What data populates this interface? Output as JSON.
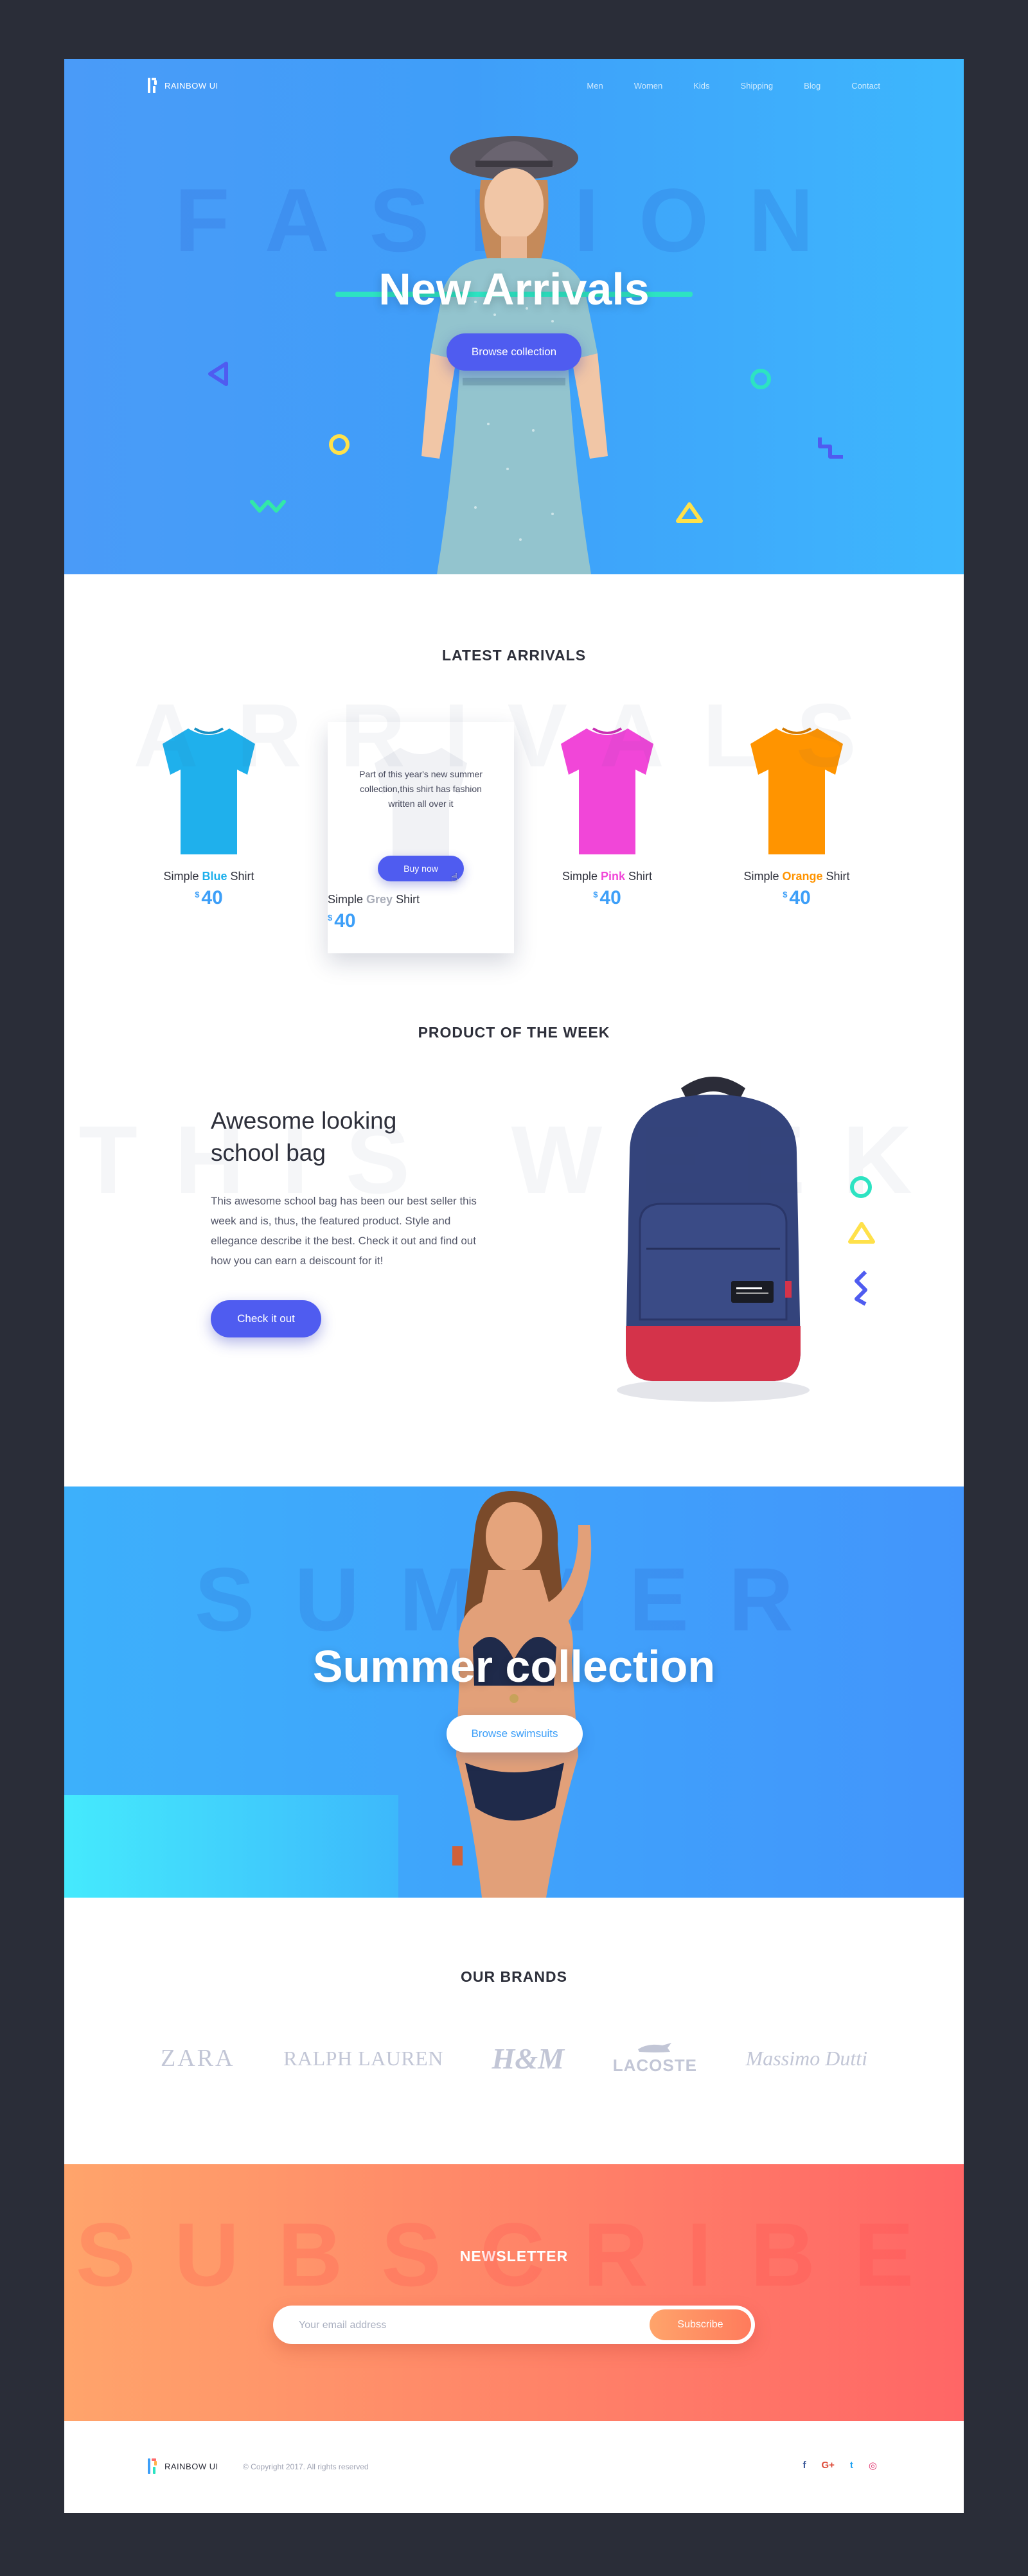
{
  "brand": {
    "name": "RAINBOW UI"
  },
  "nav": {
    "items": [
      "Men",
      "Women",
      "Kids",
      "Shipping",
      "Blog",
      "Contact"
    ]
  },
  "hero": {
    "bg_word": "FASHION",
    "title": "New Arrivals",
    "button": "Browse collection"
  },
  "latest": {
    "title": "LATEST ARRIVALS",
    "bg_word": "ARRIVALS",
    "products": [
      {
        "pre": "Simple ",
        "color": "Blue",
        "post": " Shirt",
        "currency": "$",
        "price": "40",
        "hex": "#1fb0ec"
      },
      {
        "pre": "Simple ",
        "color": "Grey",
        "post": " Shirt",
        "currency": "$",
        "price": "40",
        "hex": "#a9adb8"
      },
      {
        "pre": "Simple ",
        "color": "Pink",
        "post": " Shirt",
        "currency": "$",
        "price": "40",
        "hex": "#f146d8"
      },
      {
        "pre": "Simple ",
        "color": "Orange",
        "post": " Shirt",
        "currency": "$",
        "price": "40",
        "hex": "#ff9400"
      }
    ],
    "card": {
      "description": "Part of this year's new summer collection,this shirt has fashion written all over it",
      "button": "Buy now"
    }
  },
  "week": {
    "title": "PRODUCT OF THE WEEK",
    "bg_word": "THIS WEEK",
    "heading": "Awesome looking school bag",
    "description": "This awesome school bag has been our best seller this week and is, thus, the featured product. Style and ellegance describe it the best. Check it out and find out how you can earn a deiscount for it!",
    "button": "Check it out"
  },
  "summer": {
    "bg_word": "SUMMER",
    "title": "Summer collection",
    "button": "Browse swimsuits"
  },
  "brands": {
    "title": "OUR BRANDS",
    "items": [
      "ZARA",
      "RALPH LAUREN",
      "H&M",
      "LACOSTE",
      "Massimo Dutti"
    ]
  },
  "newsletter": {
    "bg_word": "SUBSCRIBE",
    "title": "NEWSLETTER",
    "placeholder": "Your email address",
    "button": "Subscribe"
  },
  "footer": {
    "brand": "RAINBOW UI",
    "copyright": "© Copyright 2017. All rights reserved",
    "socials": [
      "facebook-icon",
      "google-plus-icon",
      "twitter-icon",
      "instagram-icon"
    ]
  },
  "colors": {
    "accent": "#4f5cf0",
    "hero_blue": "#3f9ef9",
    "price_blue": "#3d9ff8",
    "newsletter_start": "#ffa46b",
    "newsletter_end": "#ff6666"
  }
}
